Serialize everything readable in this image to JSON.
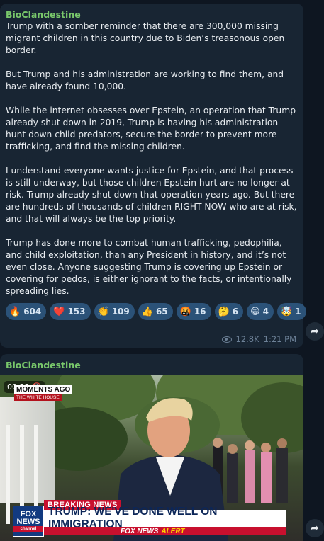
{
  "messages": [
    {
      "sender": "BioClandestine",
      "paragraphs": [
        "Trump with a somber reminder that there are 300,000 missing migrant children in this country due to Biden’s treasonous open border.",
        "But Trump and his administration are working to find them, and have already found 10,000.",
        "While the internet obsesses over Epstein, an operation that Trump already shut down in 2019, Trump is having his administration hunt down child predators, secure the border to prevent more trafficking, and find the missing children.",
        "I understand everyone wants justice for Epstein, and that process is still underway, but those children Epstein hurt are no longer at risk. Trump already shut down that operation years ago. But there are hundreds of thousands of children RIGHT NOW who are at risk, and that will always be the top priority.",
        "Trump has done more to combat human trafficking, pedophilia, and child exploitation, than any President in history, and it’s not even close. Anyone suggesting Trump is covering up Epstein or covering for pedos, is either ignorant to the facts, or intentionally spreading lies."
      ],
      "reactions": [
        {
          "emoji": "🔥",
          "count": "604"
        },
        {
          "emoji": "❤️",
          "count": "153"
        },
        {
          "emoji": "👏",
          "count": "109"
        },
        {
          "emoji": "👍",
          "count": "65"
        },
        {
          "emoji": "🤬",
          "count": "16"
        },
        {
          "emoji": "🤔",
          "count": "6"
        },
        {
          "emoji": "😁",
          "count": "4"
        },
        {
          "emoji": "🤯",
          "count": "1"
        }
      ],
      "views": "12.8K",
      "time": "1:21 PM"
    },
    {
      "sender": "BioClandestine",
      "video": {
        "duration": "00:22",
        "moments_tag": "MOMENTS AGO",
        "location_tag": "THE WHITE HOUSE",
        "breaking": "BREAKING NEWS",
        "headline": "TRUMP: WE'VE DONE WELL ON IMMIGRATION",
        "network": "FOX NEWS",
        "alert": "ALERT",
        "logo_top": "FOX",
        "logo_bottom": "NEWS",
        "logo_channel": "channel"
      }
    }
  ],
  "icons": {
    "share": "share-arrow-icon",
    "views": "eye-icon",
    "mute": "speaker-muted-icon"
  },
  "colors": {
    "background": "#0e1621",
    "bubble": "#182533",
    "sender": "#79c86b",
    "reaction_bg": "#2b5278",
    "fox_red": "#c8102e",
    "fox_blue": "#123a80"
  }
}
